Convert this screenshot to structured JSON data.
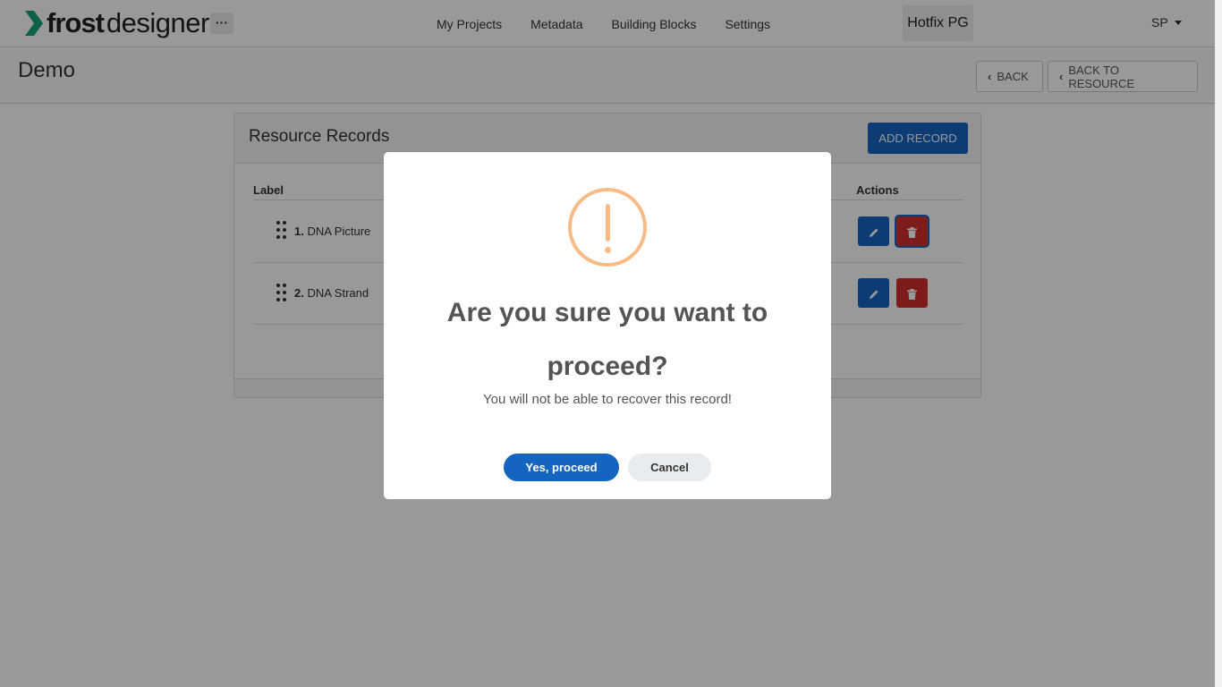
{
  "navbar": {
    "logo_bold": "frost",
    "logo_light": "designer",
    "more_label": "···",
    "links": [
      "My Projects",
      "Metadata",
      "Building Blocks",
      "Settings"
    ],
    "project_badge": "Hotfix PG",
    "user_initials": "SP"
  },
  "page": {
    "title": "Demo",
    "back_label": "BACK",
    "back_to_resource_label": "BACK TO RESOURCE"
  },
  "panel": {
    "title": "Resource Records",
    "add_record_label": "ADD RECORD",
    "columns": {
      "label": "Label",
      "actions": "Actions"
    },
    "rows": [
      {
        "index": "1.",
        "label": "DNA Picture"
      },
      {
        "index": "2.",
        "label": "DNA Strand"
      }
    ]
  },
  "modal": {
    "title": "Are you sure you want to proceed?",
    "text": "You will not be able to recover this record!",
    "confirm_label": "Yes, proceed",
    "cancel_label": "Cancel"
  },
  "colors": {
    "primary": "#1565c0",
    "danger": "#d32f2f",
    "warning": "#f8bb86",
    "logo_accent": "#1aa37a"
  },
  "icons": {
    "logo": "chevron-right-icon",
    "edit": "pencil-icon",
    "delete": "trash-icon",
    "drag": "drag-handle-icon",
    "warning": "exclamation-circle-icon"
  }
}
